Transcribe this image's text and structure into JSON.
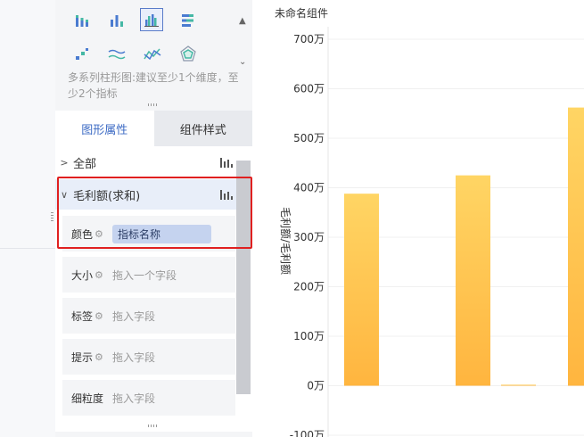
{
  "panel": {
    "chart_type_hint": "多系列柱形图:建议至少1个维度，至少2个指标",
    "chart_type_icons": [
      {
        "name": "stacked-bar-icon",
        "selected": false
      },
      {
        "name": "grouped-bar-icon",
        "selected": false
      },
      {
        "name": "multi-series-bar-icon",
        "selected": true
      },
      {
        "name": "horizontal-bar-icon",
        "selected": false
      },
      {
        "name": "scatter-icon",
        "selected": false
      },
      {
        "name": "line-icon",
        "selected": false
      },
      {
        "name": "area-line-icon",
        "selected": false
      },
      {
        "name": "radar-icon",
        "selected": false
      }
    ],
    "tabs": [
      {
        "label": "图形属性",
        "active": true
      },
      {
        "label": "组件样式",
        "active": false
      }
    ],
    "sections": {
      "all": {
        "label": "全部"
      },
      "measure": {
        "label": "毛利额(求和)"
      }
    },
    "fields": [
      {
        "name": "颜色",
        "value": "指标名称",
        "filled": true
      },
      {
        "name": "大小",
        "value": "拖入一个字段",
        "filled": false
      },
      {
        "name": "标签",
        "value": "拖入字段",
        "filled": false
      },
      {
        "name": "提示",
        "value": "拖入字段",
        "filled": false
      },
      {
        "name": "细粒度",
        "value": "拖入字段",
        "filled": false
      }
    ]
  },
  "chart": {
    "title": "未命名组件"
  },
  "chart_data": {
    "type": "bar",
    "title": "未命名组件",
    "ylabel": "毛利额/毛利额",
    "xlabel": "",
    "yticks": [
      "700万",
      "600万",
      "500万",
      "400万",
      "300万",
      "200万",
      "100万",
      "0万",
      "-100万"
    ],
    "ylim": [
      -100,
      700
    ],
    "unit": "万",
    "values": [
      388,
      425,
      2,
      562
    ],
    "colors": {
      "bar_top": "#ffd564",
      "bar_bottom": "#ffb53f"
    }
  }
}
